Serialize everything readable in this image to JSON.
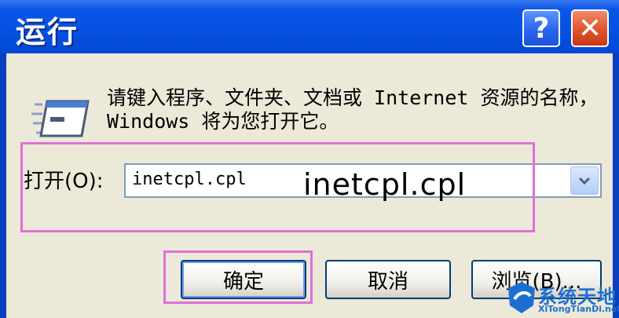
{
  "window": {
    "title": "运行",
    "help_label": "?",
    "close_label": "✕"
  },
  "dialog": {
    "description": "请键入程序、文件夹、文档或 Internet 资源的名称，Windows 将为您打开它。",
    "open_label": "打开(O):",
    "open_value": "inetcpl.cpl",
    "overlay_text": "inetcpl.cpl"
  },
  "buttons": {
    "ok": "确定",
    "cancel": "取消",
    "browse": "浏览(B)..."
  },
  "watermark": {
    "name": "系统天地",
    "site": "XiTongTianDi.net"
  },
  "colors": {
    "titlebar": "#0450e0",
    "client": "#ece9d8",
    "highlight": "#e070d8"
  }
}
